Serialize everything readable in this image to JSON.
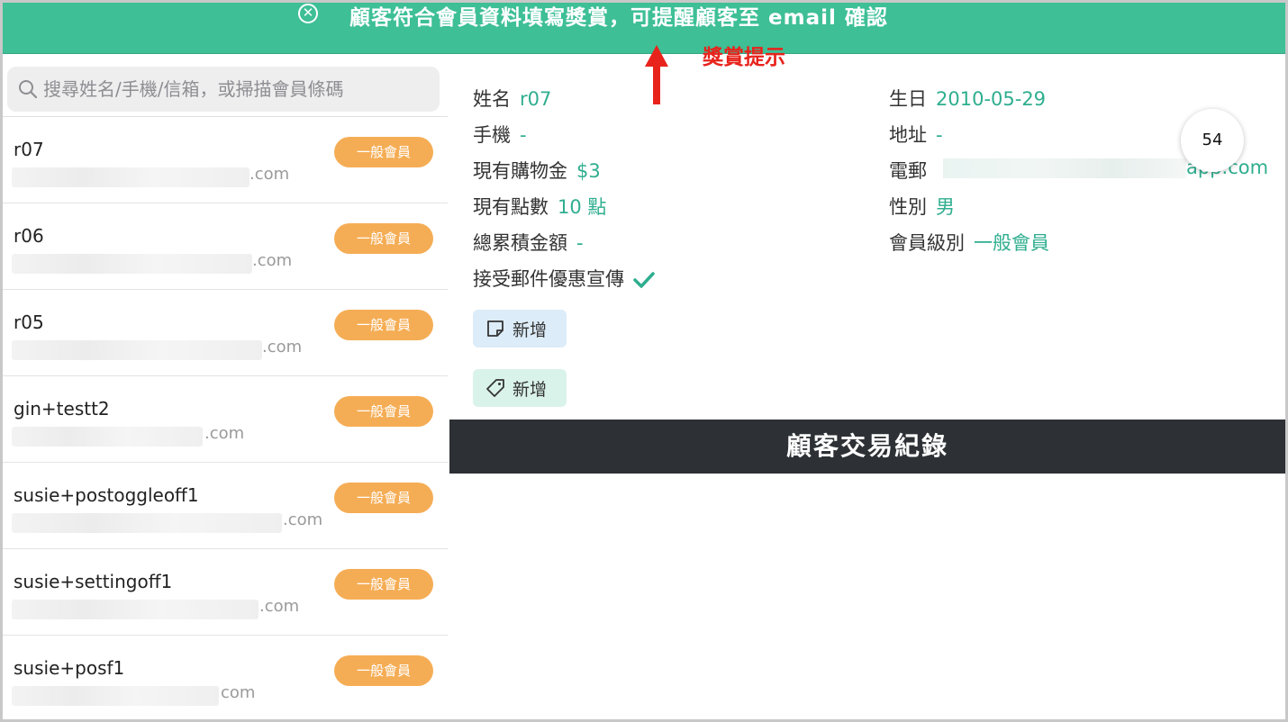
{
  "banner": {
    "close_icon": "close-circle-icon",
    "text": "顧客符合會員資料填寫獎賞，可提醒顧客至 email 確認",
    "color": "#3ebf96"
  },
  "annotation": {
    "label": "獎賞提示",
    "color": "#e8231c"
  },
  "search": {
    "placeholder": "搜尋姓名/手機/信箱，或掃描會員條碼"
  },
  "members": [
    {
      "name": "r07",
      "email_suffix": ".com",
      "level": "一般會員"
    },
    {
      "name": "r06",
      "email_suffix": ".com",
      "level": "一般會員"
    },
    {
      "name": "r05",
      "email_suffix": ".com",
      "level": "一般會員"
    },
    {
      "name": "gin+testt2",
      "email_suffix": ".com",
      "level": "一般會員"
    },
    {
      "name": "susie+postoggleoff1",
      "email_suffix": ".com",
      "level": "一般會員"
    },
    {
      "name": "susie+settingoff1",
      "email_suffix": ".com",
      "level": "一般會員"
    },
    {
      "name": "susie+posf1",
      "email_suffix": "com",
      "level": "一般會員"
    }
  ],
  "detail": {
    "name_label": "姓名",
    "name_value": "r07",
    "phone_label": "手機",
    "phone_value": "-",
    "credit_label": "現有購物金",
    "credit_value": "$3",
    "points_label": "現有點數",
    "points_value": "10 點",
    "total_label": "總累積金額",
    "total_value": "-",
    "promo_label": "接受郵件優惠宣傳",
    "birthday_label": "生日",
    "birthday_value": "2010-05-29",
    "address_label": "地址",
    "address_value": "-",
    "email_label": "電郵",
    "email_tail": "app.com",
    "gender_label": "性別",
    "gender_value": "男",
    "level_label": "會員級別",
    "level_value": "一般會員",
    "count_bubble": "54",
    "add_note_label": "新增",
    "add_tag_label": "新增",
    "accent_color": "#2fae8f"
  },
  "section": {
    "title": "顧客交易紀錄"
  }
}
